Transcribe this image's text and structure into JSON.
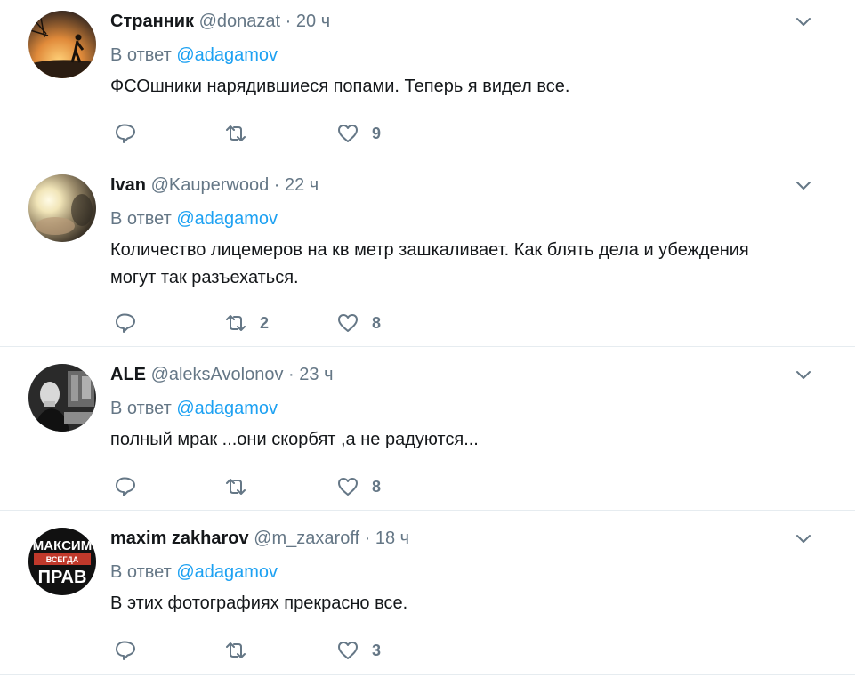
{
  "reply_prefix": "В ответ",
  "tweets": [
    {
      "name": "Странник",
      "handle": "@donazat",
      "separator": "·",
      "time": "20 ч",
      "reply_to": "@adagamov",
      "text_lines": [
        "ФСОшники нарядившиеся попами. Теперь я видел все."
      ],
      "replies": "",
      "retweets": "",
      "likes": "9"
    },
    {
      "name": "Ivan",
      "handle": "@Kauperwood",
      "separator": "·",
      "time": "22 ч",
      "reply_to": "@adagamov",
      "text_lines": [
        "Количество лицемеров на кв метр зашкаливает. Как блять дела и убеждения",
        "могут так разъехаться."
      ],
      "replies": "",
      "retweets": "2",
      "likes": "8"
    },
    {
      "name": "ALE",
      "handle": "@aleksAvolonov",
      "separator": "·",
      "time": "23 ч",
      "reply_to": "@adagamov",
      "text_lines": [
        "полный мрак ...они скорбят ,а не радуются..."
      ],
      "replies": "",
      "retweets": "",
      "likes": "8"
    },
    {
      "name": "maxim zakharov",
      "handle": "@m_zaxaroff",
      "separator": "·",
      "time": "18 ч",
      "reply_to": "@adagamov",
      "text_lines": [
        "В этих фотографиях прекрасно все."
      ],
      "replies": "",
      "retweets": "",
      "likes": "3"
    }
  ],
  "avatar4_text": {
    "top": "МАКСИМ",
    "middle": "ВСЕГДА",
    "bottom": "ПРАВ"
  },
  "colors": {
    "text": "#14171a",
    "muted": "#657786",
    "link": "#1da1f2",
    "divider": "#e6ecf0"
  }
}
